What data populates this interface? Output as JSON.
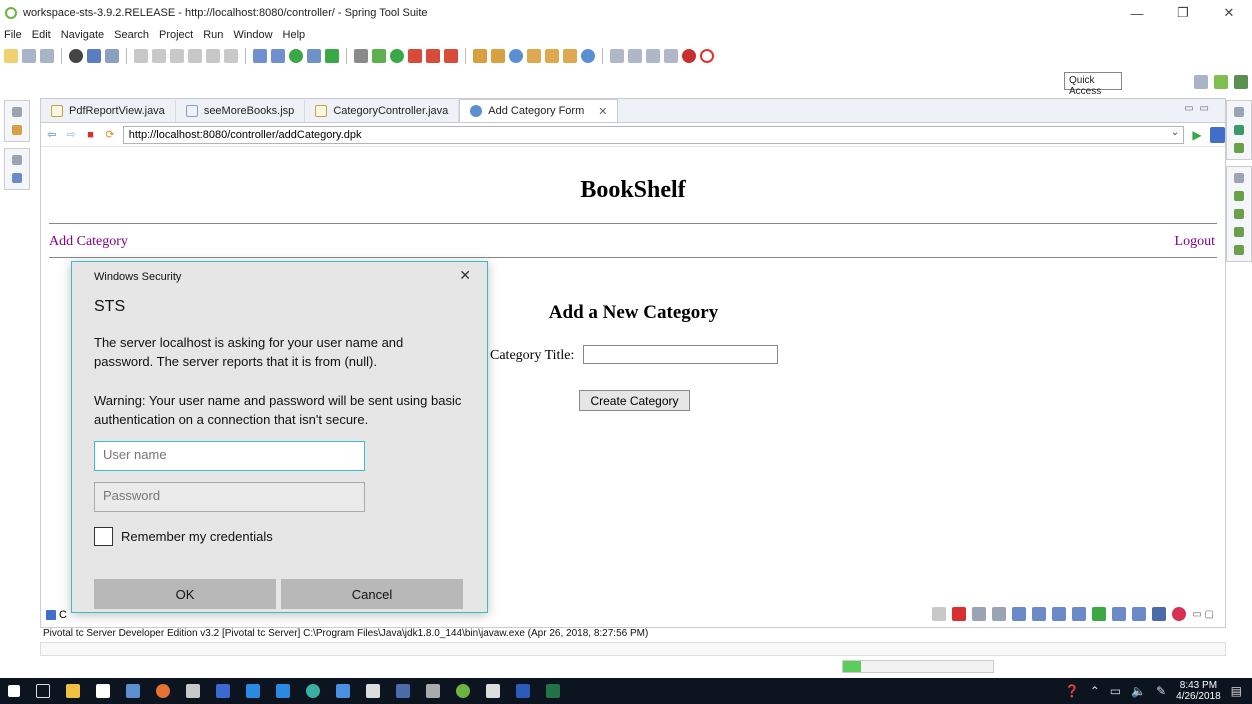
{
  "window": {
    "title": "workspace-sts-3.9.2.RELEASE - http://localhost:8080/controller/ - Spring Tool Suite"
  },
  "menu": [
    "File",
    "Edit",
    "Navigate",
    "Search",
    "Project",
    "Run",
    "Window",
    "Help"
  ],
  "quick_access": "Quick Access",
  "tabs": [
    {
      "label": "PdfReportView.java"
    },
    {
      "label": "seeMoreBooks.jsp"
    },
    {
      "label": "CategoryController.java"
    },
    {
      "label": "Add Category Form"
    }
  ],
  "browser": {
    "url": "http://localhost:8080/controller/addCategory.dpk"
  },
  "page": {
    "title": "BookShelf",
    "nav_left": "Add Category",
    "nav_right": "Logout",
    "heading": "Add a New Category",
    "category_label": "Category Title:",
    "category_value": "",
    "create_button": "Create Category"
  },
  "console": {
    "tab_label": "C",
    "line": "Pivotal tc Server Developer Edition v3.2 [Pivotal tc Server] C:\\Program Files\\Java\\jdk1.8.0_144\\bin\\javaw.exe (Apr 26, 2018, 8:27:56 PM)"
  },
  "progress": 0.12,
  "dialog": {
    "title": "Windows Security",
    "heading": "STS",
    "message": "The server localhost is asking for your user name and password. The server reports that it is from (null).",
    "warning": "Warning: Your user name and password will be sent using basic authentication on a connection that isn't secure.",
    "username_placeholder": "User name",
    "password_placeholder": "Password",
    "remember_label": "Remember my credentials",
    "ok_label": "OK",
    "cancel_label": "Cancel"
  },
  "clock": {
    "time": "8:43 PM",
    "date": "4/26/2018"
  },
  "colors": {
    "accent": "#3dbcc8",
    "link": "#800080",
    "taskbar": "#0c1420"
  }
}
